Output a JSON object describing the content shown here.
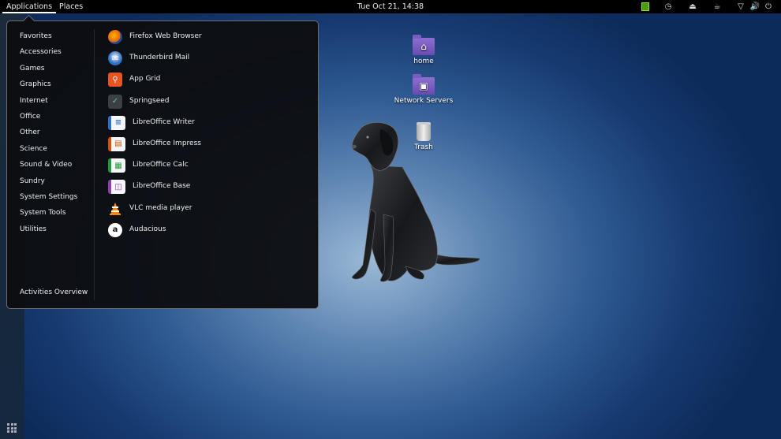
{
  "topbar": {
    "applications": "Applications",
    "places": "Places",
    "clock": "Tue Oct 21, 14:38"
  },
  "desktop": {
    "icons": [
      {
        "label": "home",
        "icon": "home-folder-icon"
      },
      {
        "label": "Network Servers",
        "icon": "network-folder-icon"
      },
      {
        "label": "Trash",
        "icon": "trash-icon"
      }
    ]
  },
  "menu": {
    "categories": [
      "Favorites",
      "Accessories",
      "Games",
      "Graphics",
      "Internet",
      "Office",
      "Other",
      "Science",
      "Sound & Video",
      "Sundry",
      "System Settings",
      "System Tools",
      "Utilities"
    ],
    "activities": "Activities Overview",
    "apps": [
      {
        "label": "Firefox Web Browser",
        "icon": "firefox-icon",
        "color": "#e66000"
      },
      {
        "label": "Thunderbird Mail",
        "icon": "thunderbird-icon",
        "color": "#2b6fc2"
      },
      {
        "label": "App Grid",
        "icon": "app-grid-icon",
        "color": "#e95420"
      },
      {
        "label": "Springseed",
        "icon": "springseed-icon",
        "color": "#3c3f44"
      },
      {
        "label": "LibreOffice Writer",
        "icon": "libreoffice-writer-icon",
        "color": "#2a6fc9"
      },
      {
        "label": "LibreOffice Impress",
        "icon": "libreoffice-impress-icon",
        "color": "#d35400"
      },
      {
        "label": "LibreOffice Calc",
        "icon": "libreoffice-calc-icon",
        "color": "#1e9c3a"
      },
      {
        "label": "LibreOffice Base",
        "icon": "libreoffice-base-icon",
        "color": "#8e3cae"
      },
      {
        "label": "VLC media player",
        "icon": "vlc-icon",
        "color": "#ff8800"
      },
      {
        "label": "Audacious",
        "icon": "audacious-icon",
        "color": "#ffffff"
      }
    ]
  }
}
